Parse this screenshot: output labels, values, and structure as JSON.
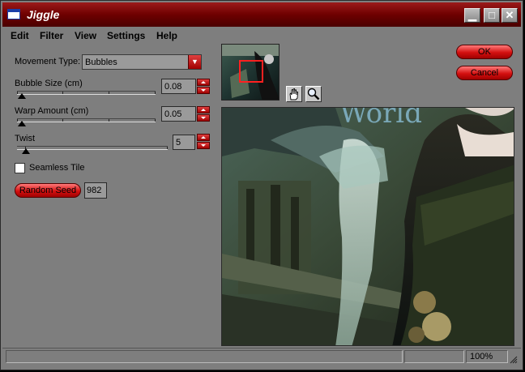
{
  "window": {
    "title": "Jiggle"
  },
  "title_buttons": {
    "minimize": "▁",
    "maximize": "□",
    "close": "✕"
  },
  "menu": [
    "Edit",
    "Filter",
    "View",
    "Settings",
    "Help"
  ],
  "controls": {
    "movement_type_label": "Movement Type:",
    "movement_type_value": "Bubbles",
    "bubble_size_label": "Bubble Size (cm)",
    "bubble_size_value": "0.08",
    "warp_amount_label": "Warp Amount (cm)",
    "warp_amount_value": "0.05",
    "twist_label": "Twist",
    "twist_value": "5",
    "seamless_tile_label": "Seamless Tile",
    "seamless_tile_checked": false,
    "random_seed_label": "Random Seed",
    "random_seed_value": "982"
  },
  "buttons": {
    "ok": "OK",
    "cancel": "Cancel"
  },
  "preview": {
    "text": "World"
  },
  "status": {
    "zoom": "100%"
  },
  "colors": {
    "accent": "#cc0000",
    "titlebar": "#6e0000",
    "window": "#7e7e7e"
  }
}
